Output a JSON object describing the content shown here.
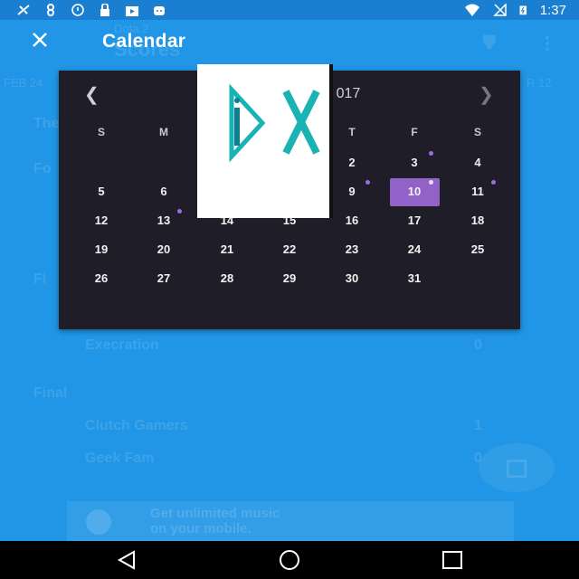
{
  "status_bar": {
    "time": "1:37",
    "icons": [
      "satellite-icon",
      "data-icon",
      "clock-icon",
      "lock-icon",
      "play-store-icon",
      "android-icon",
      "wifi-icon",
      "no-signal-icon",
      "battery-icon"
    ]
  },
  "toolbar": {
    "title": "Calendar",
    "ghost_title": "Dota 2",
    "ghost_subtitle": "Scores"
  },
  "background": {
    "date_left": "FEB 24",
    "date_right": "R 12",
    "section_the": "The",
    "section_fo": "Fo",
    "section_fi": "Fi",
    "section_final": "Final",
    "rows": [
      {
        "name": "Execration",
        "score": "0"
      },
      {
        "name": "Clutch Gamers",
        "score": "1"
      },
      {
        "name": "Geek Fam",
        "score": "0"
      }
    ]
  },
  "calendar": {
    "month_label": "017",
    "weekdays": [
      "S",
      "M",
      "",
      "",
      "T",
      "F",
      "S"
    ],
    "weeks": [
      [
        "",
        "",
        "",
        "",
        "2",
        "3",
        "4"
      ],
      [
        "5",
        "6",
        "",
        "",
        "9",
        "10",
        "11"
      ],
      [
        "12",
        "13",
        "14",
        "15",
        "16",
        "17",
        "18"
      ],
      [
        "19",
        "20",
        "21",
        "22",
        "23",
        "24",
        "25"
      ],
      [
        "26",
        "27",
        "28",
        "29",
        "30",
        "31",
        ""
      ]
    ],
    "selected_day": "10",
    "accent_color": "#9262c9"
  },
  "ad": {
    "banner_line1": "Get unlimited music",
    "banner_line2": "on your mobile."
  },
  "navbar": {
    "buttons": [
      "back-button",
      "home-button",
      "recents-button"
    ]
  }
}
